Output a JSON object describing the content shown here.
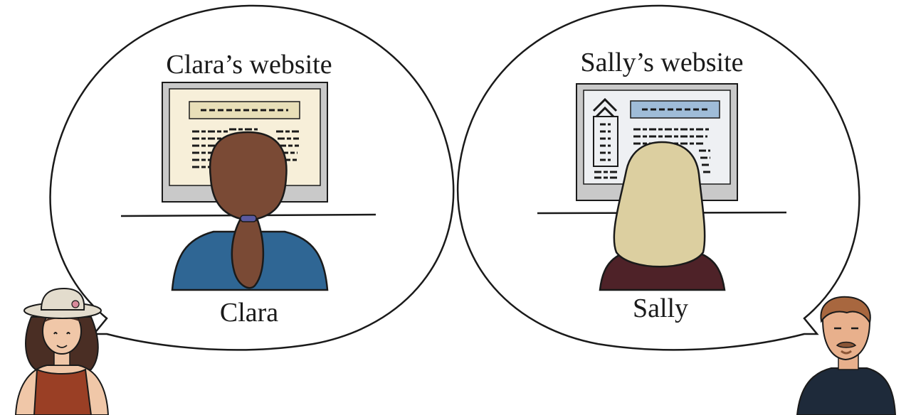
{
  "left_bubble": {
    "title": "Clara’s website",
    "person_label": "Clara"
  },
  "right_bubble": {
    "title": "Sally’s website",
    "person_label": "Sally"
  },
  "colors": {
    "outline": "#1a1a1a",
    "monitor_frame": "#c9c9c9",
    "left_screen": "#f7efd9",
    "left_header_bar": "#e8dfb8",
    "right_screen": "#eef0f3",
    "right_header_bar": "#9fbcd8",
    "clara_hair": "#7a4a35",
    "clara_shirt": "#2f6694",
    "sally_hair": "#dccfa0",
    "sally_shirt": "#4e2228",
    "woman_dress": "#9a3f25",
    "woman_hat": "#e3dccd",
    "man_shirt": "#1e2a3a"
  }
}
